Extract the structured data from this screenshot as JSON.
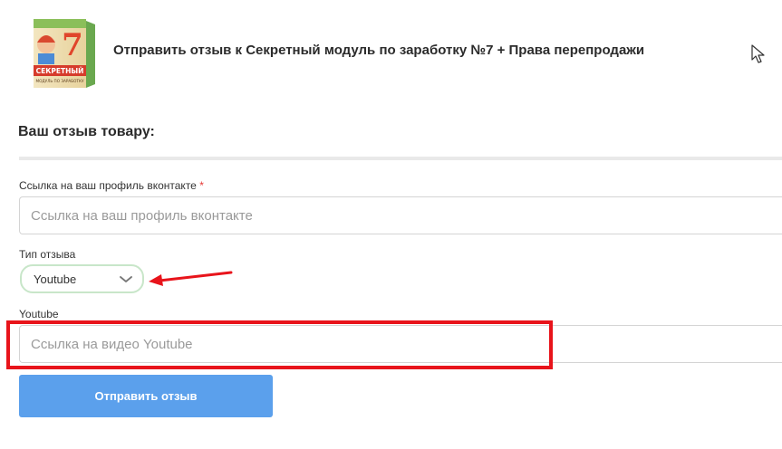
{
  "header": {
    "product_title": "Отправить отзыв к Секретный модуль по заработку №7 + Права перепродажи",
    "thumbnail": {
      "big_number": "7",
      "label_main": "СЕКРЕТНЫЙ",
      "label_sub": "МОДУЛЬ ПО ЗАРАБОТКУ"
    }
  },
  "form": {
    "title": "Ваш отзыв товару:",
    "vk_field": {
      "label": "Ссылка на ваш профиль вконтакте",
      "required_mark": "*",
      "placeholder": "Ссылка на ваш профиль вконтакте",
      "value": ""
    },
    "review_type": {
      "label": "Тип отзыва",
      "selected": "Youtube"
    },
    "youtube_field": {
      "label": "Youtube",
      "placeholder": "Ссылка на видео Youtube",
      "value": ""
    },
    "submit_label": "Отправить отзыв"
  },
  "colors": {
    "accent_button": "#5ba0ec",
    "annotation_red": "#e8141b",
    "select_border": "#c8e6c9"
  },
  "icons": {
    "select_chevron": "chevron-down-icon",
    "annotation_arrow": "arrow-left-icon",
    "mouse_cursor": "cursor-icon"
  }
}
